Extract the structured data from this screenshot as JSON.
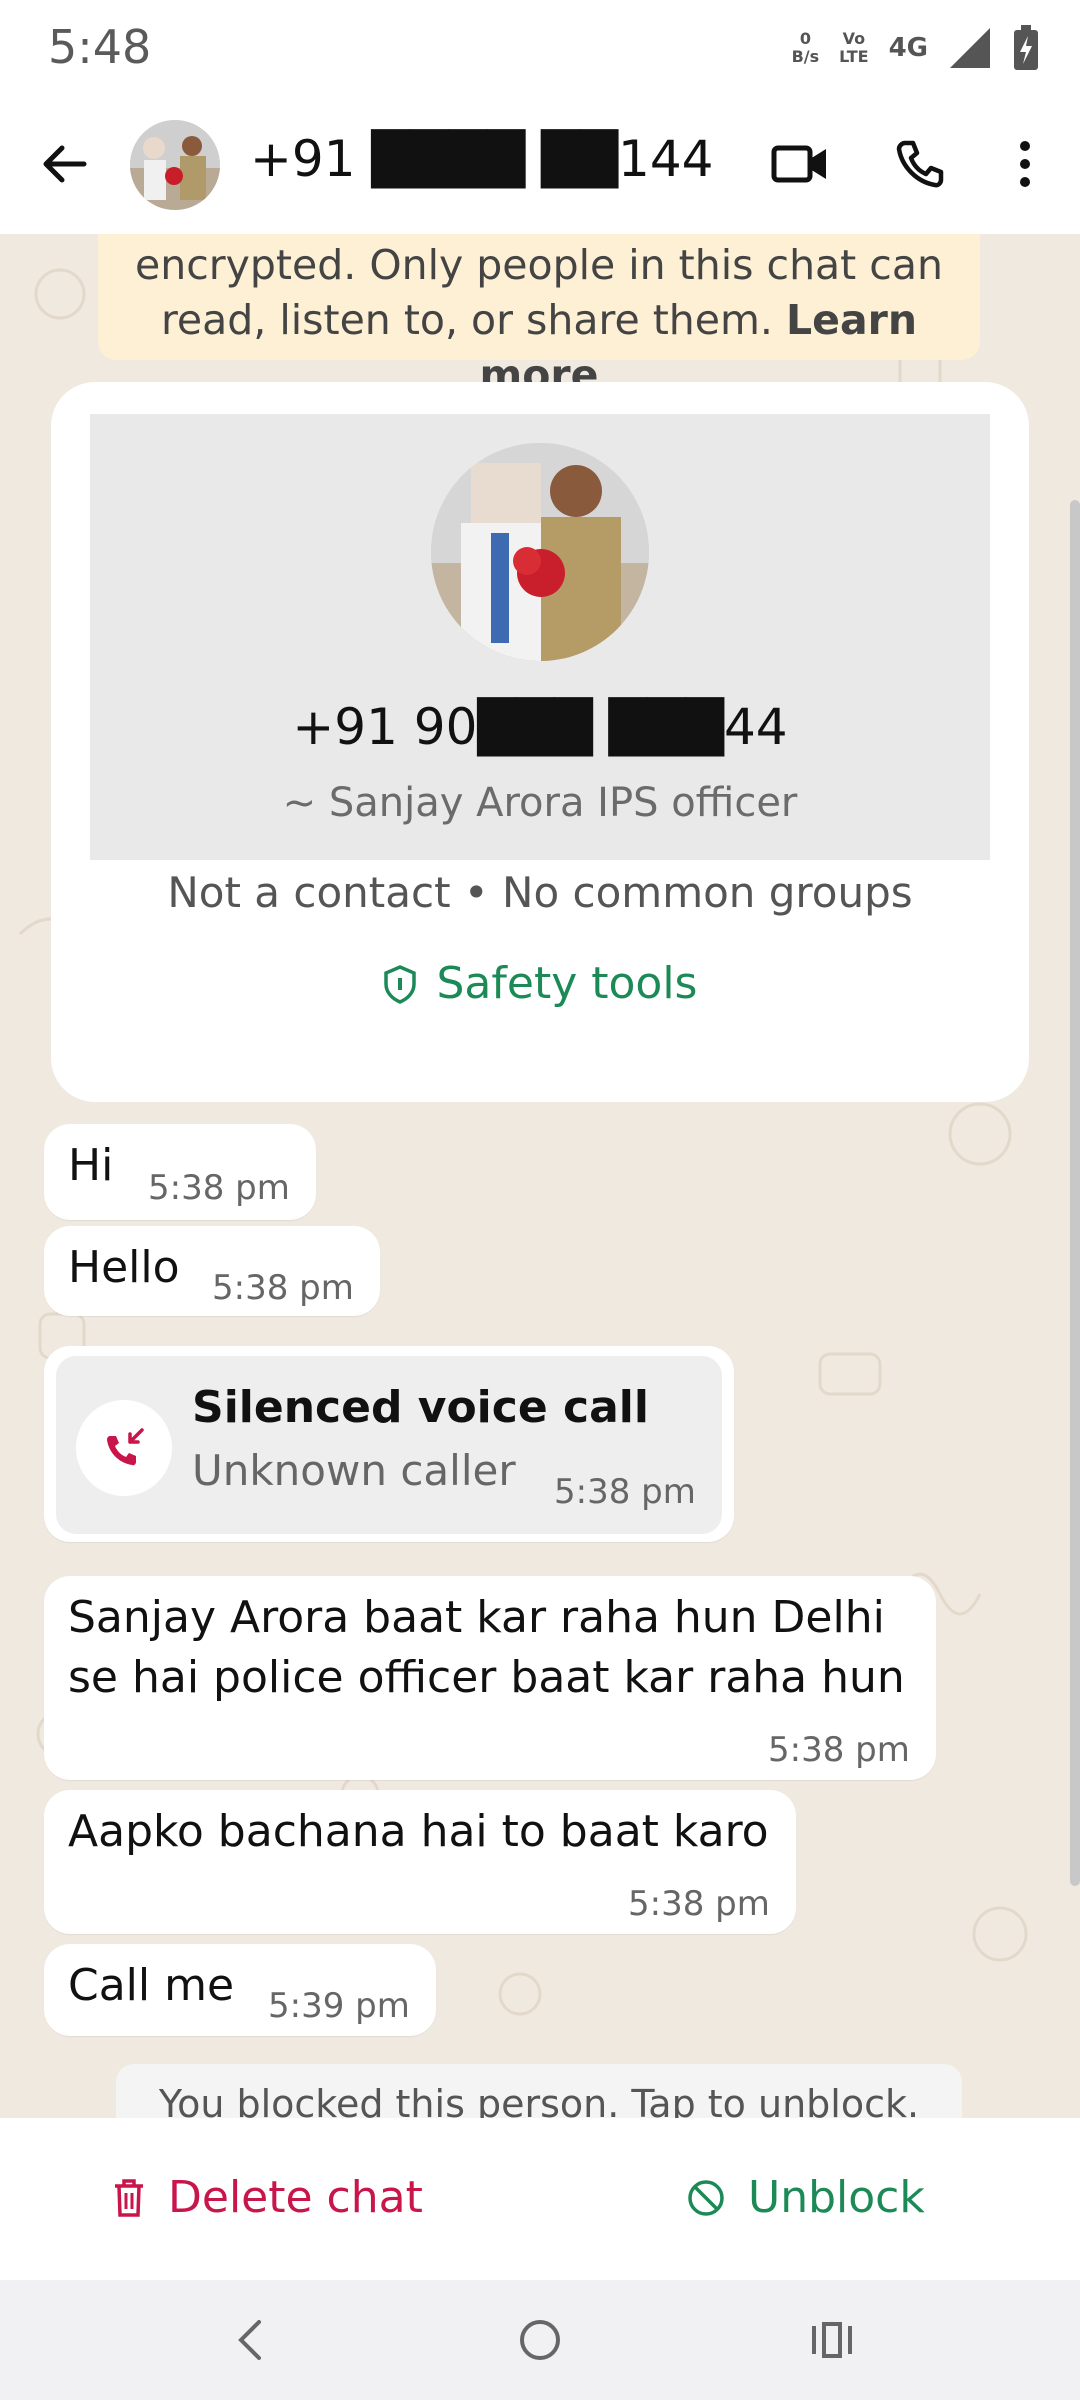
{
  "status": {
    "time": "5:48",
    "data_speed_top": "0",
    "data_speed_bottom": "B/s",
    "volte_top": "Vo",
    "volte_bottom": "LTE",
    "network": "4G"
  },
  "header": {
    "title": "+91 ████ ██144",
    "icons": [
      "back-arrow-icon",
      "video-call-icon",
      "voice-call-icon",
      "more-options-icon"
    ]
  },
  "encryption_notice": {
    "line1": "encrypted. Only people in this chat can",
    "line2": "read, listen to, or share them.",
    "link": "Learn more"
  },
  "contact_card": {
    "phone": "+91 90███ ███44",
    "alias": "~ Sanjay Arora IPS officer",
    "meta": "Not a contact • No common groups",
    "safety": "Safety tools"
  },
  "messages": [
    {
      "text": "Hi",
      "time": "5:38 pm"
    },
    {
      "text": "Hello",
      "time": "5:38 pm"
    },
    {
      "text": "Sanjay Arora baat kar raha hun Delhi",
      "text2": "se hai police officer baat kar raha hun",
      "time": "5:38 pm"
    },
    {
      "text": "Aapko bachana hai to baat karo",
      "time": "5:38 pm"
    },
    {
      "text": "Call me",
      "time": "5:39 pm"
    }
  ],
  "call": {
    "title": "Silenced voice call",
    "subtitle": "Unknown caller",
    "time": "5:38 pm"
  },
  "blocked_notice": "You blocked this person. Tap to unblock.",
  "actions": {
    "delete": "Delete chat",
    "unblock": "Unblock"
  },
  "colors": {
    "red": "#c8154a",
    "green": "#1c8a57",
    "wallpaper": "#efe9df",
    "notice": "#fdf0d4"
  }
}
